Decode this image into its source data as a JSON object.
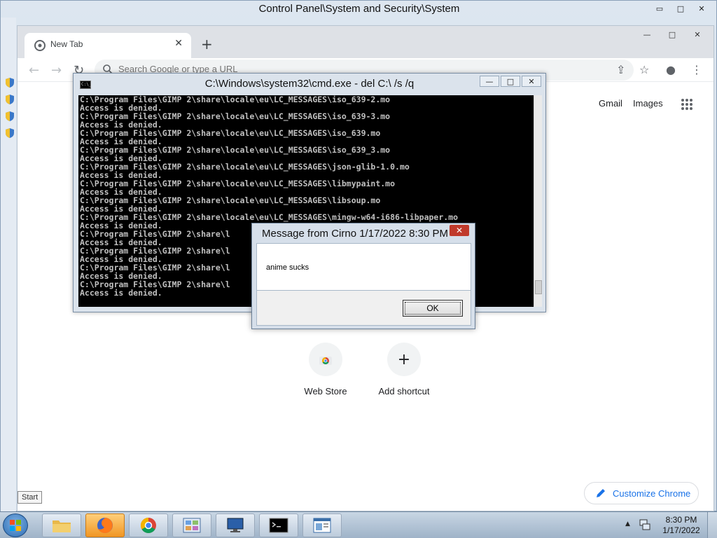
{
  "control_panel": {
    "title": "Control Panel\\System and Security\\System",
    "controls": [
      "▭",
      "□",
      "✕"
    ]
  },
  "chrome": {
    "tab_title": "New Tab",
    "tab_close": "✕",
    "new_tab": "+",
    "controls": [
      "—",
      "□",
      "✕"
    ],
    "omnibox_placeholder": "Search Google or type a URL",
    "gmail": "Gmail",
    "images": "Images",
    "shortcuts": [
      {
        "label": "Web Store",
        "icon": "webstore-icon"
      },
      {
        "label": "Add shortcut",
        "icon": "plus-icon"
      }
    ],
    "add_glyph": "+",
    "customize": "Customize Chrome"
  },
  "cmd": {
    "title": "C:\\Windows\\system32\\cmd.exe - del  C:\\ /s /q",
    "icon_text": "C:\\_",
    "controls": [
      "—",
      "□",
      "✕"
    ],
    "lines": [
      "C:\\Program Files\\GIMP 2\\share\\locale\\eu\\LC_MESSAGES\\iso_639-2.mo",
      "Access is denied.",
      "C:\\Program Files\\GIMP 2\\share\\locale\\eu\\LC_MESSAGES\\iso_639-3.mo",
      "Access is denied.",
      "C:\\Program Files\\GIMP 2\\share\\locale\\eu\\LC_MESSAGES\\iso_639.mo",
      "Access is denied.",
      "C:\\Program Files\\GIMP 2\\share\\locale\\eu\\LC_MESSAGES\\iso_639_3.mo",
      "Access is denied.",
      "C:\\Program Files\\GIMP 2\\share\\locale\\eu\\LC_MESSAGES\\json-glib-1.0.mo",
      "Access is denied.",
      "C:\\Program Files\\GIMP 2\\share\\locale\\eu\\LC_MESSAGES\\libmypaint.mo",
      "Access is denied.",
      "C:\\Program Files\\GIMP 2\\share\\locale\\eu\\LC_MESSAGES\\libsoup.mo",
      "Access is denied.",
      "C:\\Program Files\\GIMP 2\\share\\locale\\eu\\LC_MESSAGES\\mingw-w64-i686-libpaper.mo",
      "Access is denied.",
      "C:\\Program Files\\GIMP 2\\share\\l",
      "Access is denied.",
      "C:\\Program Files\\GIMP 2\\share\\l",
      "Access is denied.",
      "C:\\Program Files\\GIMP 2\\share\\l",
      "Access is denied.",
      "C:\\Program Files\\GIMP 2\\share\\l",
      "Access is denied."
    ]
  },
  "msgbox": {
    "title": "Message from Cirno 1/17/2022 8:30 PM",
    "close": "✕",
    "text": "anime sucks",
    "ok": "OK"
  },
  "start_tooltip": "Start",
  "taskbar": {
    "apps": [
      {
        "name": "explorer",
        "icon": "folder-icon"
      },
      {
        "name": "firefox",
        "icon": "firefox-icon"
      },
      {
        "name": "chrome",
        "icon": "chrome-icon"
      },
      {
        "name": "control-panel",
        "icon": "control-panel-icon"
      },
      {
        "name": "remote-desktop",
        "icon": "monitor-icon"
      },
      {
        "name": "cmd",
        "icon": "cmd-icon"
      },
      {
        "name": "notepad",
        "icon": "window-icon"
      }
    ],
    "tray_arrow": "▲",
    "time": "8:30 PM",
    "date": "1/17/2022"
  }
}
